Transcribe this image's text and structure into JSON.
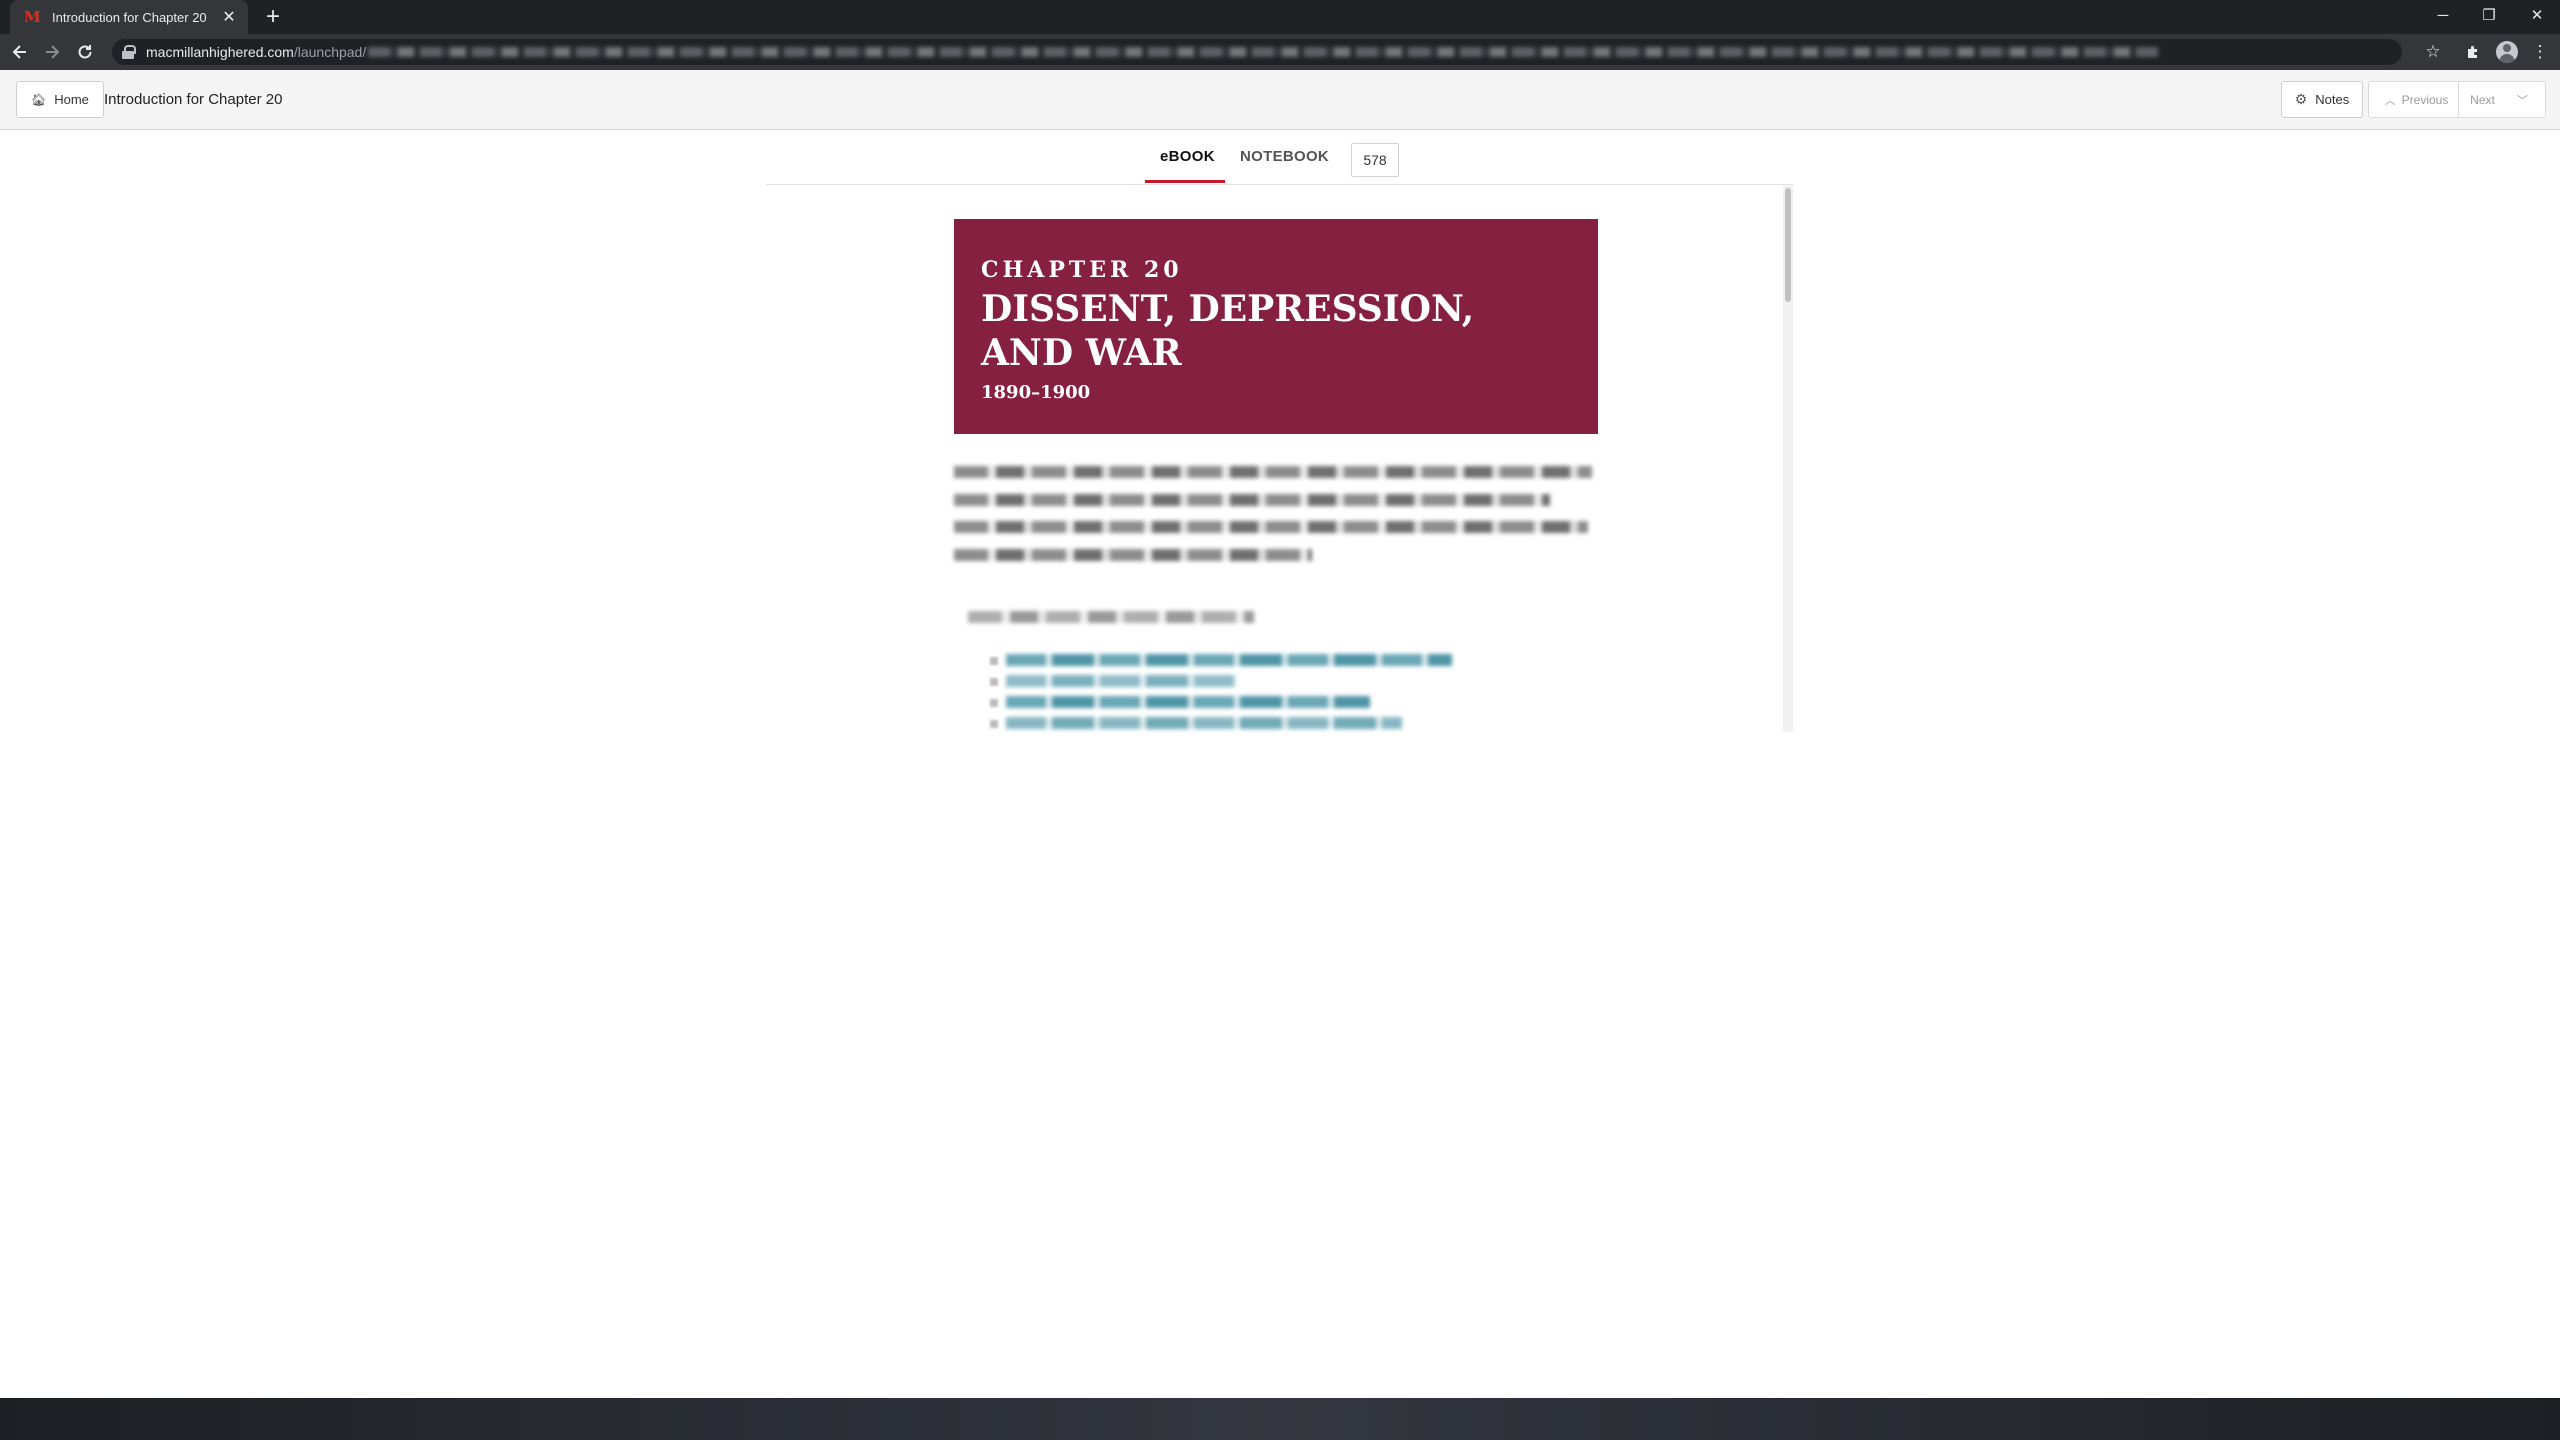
{
  "browser": {
    "tab_title": "Introduction for Chapter 20",
    "favicon_letter": "M",
    "url_host": "macmillanhighered.com",
    "url_path": "/launchpad/",
    "window_controls": {
      "minimize": "─",
      "restore": "❐",
      "close": "✕"
    }
  },
  "app_header": {
    "home_label": "Home",
    "page_title": "Introduction for Chapter 20",
    "notes_label": "Notes",
    "previous_label": "Previous",
    "next_label": "Next"
  },
  "reader": {
    "tabs": [
      {
        "label": "eBOOK",
        "active": true
      },
      {
        "label": "NOTEBOOK",
        "active": false
      }
    ],
    "page_number": "578"
  },
  "chapter": {
    "label": "CHAPTER 20",
    "title": "DISSENT, DEPRESSION, AND WAR",
    "dates": "1890–1900",
    "banner_color": "#862041"
  },
  "colors": {
    "accent_underline": "#c01a2d",
    "link_blur": "#4f95a6"
  },
  "icons": {
    "back": "back-arrow-icon",
    "forward": "forward-arrow-icon",
    "reload": "reload-icon",
    "lock": "lock-icon",
    "star": "bookmark-star-icon",
    "extensions": "puzzle-icon",
    "menu": "kebab-menu-icon",
    "home": "home-icon",
    "notes": "gear-icon"
  }
}
